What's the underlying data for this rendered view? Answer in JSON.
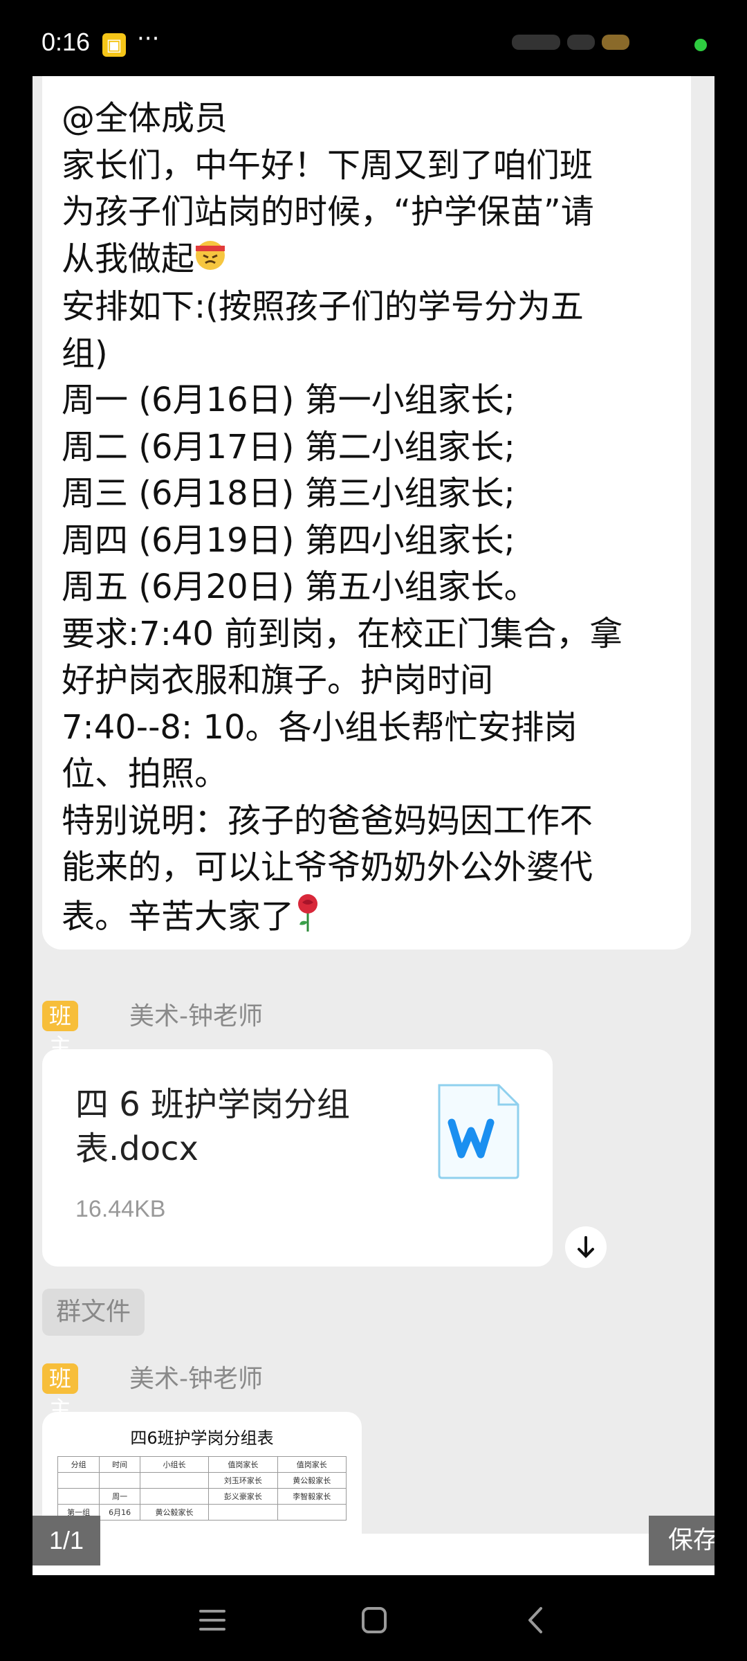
{
  "status_bar": {
    "time": "0:16",
    "app_icon": "notification-app-icon",
    "more": "···"
  },
  "message": {
    "lines": [
      "@全体成员",
      "家长们，中午好！下周又到了咱们班",
      "为孩子们站岗的时候，“护学保苗”请",
      "从我做起",
      "安排如下:(按照孩子们的学号分为五",
      "组)",
      "周一 (6月16日) 第一小组家长;",
      "周二 (6月17日) 第二小组家长;",
      "周三 (6月18日) 第三小组家长;",
      "周四 (6月19日) 第四小组家长;",
      "周五 (6月20日) 第五小组家长。",
      "要求:7:40 前到岗，在校正门集合，拿",
      "好护岗衣服和旗子。护岗时间",
      " 7:40--8: 10。各小组长帮忙安排岗",
      "位、拍照。",
      "特别说明：孩子的爸爸妈妈因工作不",
      "能来的，可以让爷爷奶奶外公外婆代",
      "表。辛苦大家了"
    ],
    "emoji_1": "determined-face-emoji",
    "emoji_2": "rose-emoji"
  },
  "sender_1": {
    "role": "班主任",
    "name": "美术-钟老师"
  },
  "file": {
    "name": "四 6 班护学岗分组表.docx",
    "size": "16.44KB",
    "icon": "word-doc-icon"
  },
  "group_file_label": "群文件",
  "sender_2": {
    "role": "班主任",
    "name": "美术-钟老师"
  },
  "thumbnail": {
    "title": "四6班护学岗分组表",
    "headers": [
      "分组",
      "时间",
      "小组长",
      "值岗家长",
      "值岗家长"
    ],
    "rows": [
      [
        "",
        "",
        "",
        "刘玉环家长",
        "黄公毅家长"
      ],
      [
        "",
        "周一",
        "",
        "彭义豪家长",
        "李智毅家长"
      ],
      [
        "第一组",
        "6月16",
        "黄公毅家长",
        "",
        ""
      ]
    ]
  },
  "viewer": {
    "page_indicator": "1/1",
    "save_label": "保存"
  },
  "colors": {
    "badge": "#f7be3a",
    "word_blue": "#1a8ff0",
    "background": "#ececec"
  }
}
